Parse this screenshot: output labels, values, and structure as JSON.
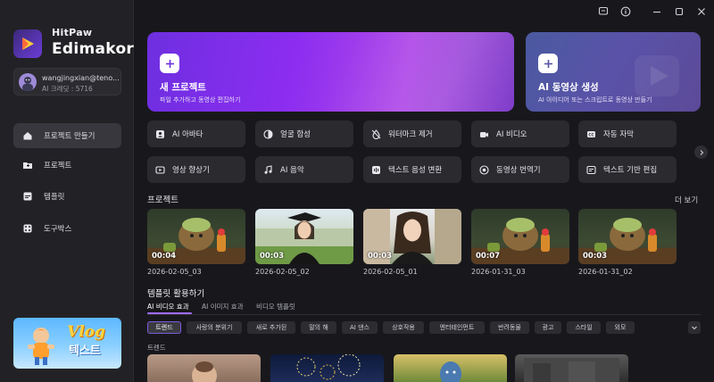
{
  "brand": {
    "line1": "HitPaw",
    "line2": "Edimakor"
  },
  "user": {
    "email": "wangjingxian@teno...",
    "credit": "AI 크레딧 : 5716"
  },
  "nav": [
    {
      "label": "프로젝트 만들기",
      "icon": "home-icon",
      "active": true
    },
    {
      "label": "프로젝트",
      "icon": "folder-icon",
      "active": false
    },
    {
      "label": "템플릿",
      "icon": "template-icon",
      "active": false
    },
    {
      "label": "도구박스",
      "icon": "toolbox-icon",
      "active": false
    }
  ],
  "promo": {
    "title": "Vlog",
    "text": "텍스트"
  },
  "hero": {
    "new_project": {
      "title": "새 프로젝트",
      "subtitle": "파일 추가하고 동영상 편집하기"
    },
    "ai_video": {
      "title": "AI 동영상 생성",
      "subtitle": "AI 아이디어 또는 스크립트로 동영상 만들기"
    }
  },
  "tools": [
    {
      "label": "AI 아바타",
      "icon": "avatar-icon"
    },
    {
      "label": "얼굴 합성",
      "icon": "face-swap-icon"
    },
    {
      "label": "워터마크 제거",
      "icon": "watermark-remove-icon"
    },
    {
      "label": "AI 비디오",
      "icon": "ai-video-icon"
    },
    {
      "label": "자동 자막",
      "icon": "subtitle-icon"
    },
    {
      "label": "영상 향상기",
      "icon": "video-enhance-icon"
    },
    {
      "label": "AI 음악",
      "icon": "music-icon"
    },
    {
      "label": "텍스트 음성 변환",
      "icon": "text-to-speech-icon"
    },
    {
      "label": "동영상 번역기",
      "icon": "translate-icon"
    },
    {
      "label": "텍스트 기반 편집",
      "icon": "text-edit-icon"
    }
  ],
  "projects_section": {
    "title": "프로젝트",
    "more": "더 보기"
  },
  "projects": [
    {
      "duration": "00:04",
      "date": "2026-02-05_03",
      "thumb": "cartoon"
    },
    {
      "duration": "00:03",
      "date": "2026-02-05_02",
      "thumb": "graduate"
    },
    {
      "duration": "00:03",
      "date": "2026-02-05_01",
      "thumb": "graduate"
    },
    {
      "duration": "00:07",
      "date": "2026-01-31_03",
      "thumb": "cartoon"
    },
    {
      "duration": "00:03",
      "date": "2026-01-31_02",
      "thumb": "cartoon"
    }
  ],
  "templates_section": {
    "title": "템플릿 활용하기"
  },
  "template_tabs": [
    {
      "label": "AI 비디오 효과",
      "active": true
    },
    {
      "label": "AI 이미지 효과",
      "active": false
    },
    {
      "label": "비디오 템플릿",
      "active": false
    }
  ],
  "chips": [
    {
      "label": "트렌드",
      "active": true
    },
    {
      "label": "사랑의 분위기",
      "active": false
    },
    {
      "label": "새로 추가된",
      "active": false
    },
    {
      "label": "말의 해",
      "active": false
    },
    {
      "label": "AI 댄스",
      "active": false
    },
    {
      "label": "상호작용",
      "active": false
    },
    {
      "label": "엔터테인먼트",
      "active": false
    },
    {
      "label": "반려동물",
      "active": false
    },
    {
      "label": "광고",
      "active": false
    },
    {
      "label": "스타일",
      "active": false
    },
    {
      "label": "외모",
      "active": false
    }
  ],
  "trend_label": "트렌드",
  "colors": {
    "accent": "#8c2df0",
    "sidebar": "#222226",
    "background": "#18181c",
    "tile": "#2a2a2f"
  }
}
